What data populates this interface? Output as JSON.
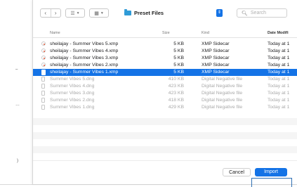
{
  "toolbar": {
    "nav_back": "‹",
    "nav_forward": "›",
    "view_list_glyph": "☰",
    "view_grid_glyph": "▦",
    "folder_name": "Preset Files",
    "search_placeholder": "Search"
  },
  "columns": {
    "name": "Name",
    "size": "Size",
    "kind": "Kind",
    "date": "Date Modifi"
  },
  "files": [
    {
      "name": "sheilajay - Summer Vibes 5.xmp",
      "size": "5 KB",
      "kind": "XMP Sidecar",
      "date": "Today at 1",
      "state": "xmp"
    },
    {
      "name": "sheilajay - Summer Vibes 4.xmp",
      "size": "5 KB",
      "kind": "XMP Sidecar",
      "date": "Today at 1",
      "state": "xmp"
    },
    {
      "name": "sheilajay - Summer Vibes 3.xmp",
      "size": "5 KB",
      "kind": "XMP Sidecar",
      "date": "Today at 1",
      "state": "xmp"
    },
    {
      "name": "sheilajay - Summer Vibes 2.xmp",
      "size": "5 KB",
      "kind": "XMP Sidecar",
      "date": "Today at 1",
      "state": "xmp"
    },
    {
      "name": "sheilajay - Summer Vibes 1.xmp",
      "size": "5 KB",
      "kind": "XMP Sidecar",
      "date": "Today at 1",
      "state": "sel"
    },
    {
      "name": "Summer Vibes 5.dng",
      "size": "410 KB",
      "kind": "Digital Negative file",
      "date": "Today at 1",
      "state": "dng"
    },
    {
      "name": "Summer Vibes 4.dng",
      "size": "423 KB",
      "kind": "Digital Negative file",
      "date": "Today at 1",
      "state": "dng"
    },
    {
      "name": "Summer Vibes 3.dng",
      "size": "423 KB",
      "kind": "Digital Negative file",
      "date": "Today at 1",
      "state": "dng"
    },
    {
      "name": "Summer Vibes 2.dng",
      "size": "418 KB",
      "kind": "Digital Negative file",
      "date": "Today at 1",
      "state": "dng"
    },
    {
      "name": "Summer Vibes 1.dng",
      "size": "429 KB",
      "kind": "Digital Negative file",
      "date": "Today at 1",
      "state": "dng"
    }
  ],
  "buttons": {
    "cancel": "Cancel",
    "import": "Import"
  },
  "colors": {
    "accent": "#1473e6",
    "folder": "#2f9bd7",
    "disabled_text": "#a9a9a9"
  }
}
